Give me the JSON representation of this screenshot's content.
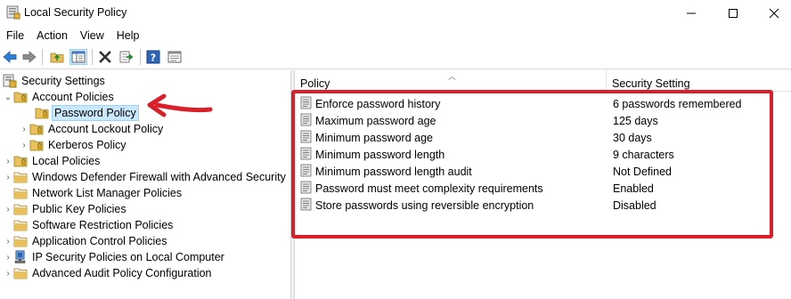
{
  "window": {
    "title": "Local Security Policy",
    "controls": [
      "minimize",
      "maximize",
      "close"
    ]
  },
  "menu": [
    "File",
    "Action",
    "View",
    "Help"
  ],
  "toolbar": {
    "buttons": [
      "back-icon",
      "forward-icon",
      "up-folder-icon",
      "show-hide-tree-icon",
      "delete-icon",
      "export-list-icon",
      "help-icon",
      "properties-icon"
    ]
  },
  "tree": {
    "root": "Security Settings",
    "items": [
      {
        "label": "Account Policies",
        "expanded": true,
        "level": 1
      },
      {
        "label": "Password Policy",
        "selected": true,
        "level": 2
      },
      {
        "label": "Account Lockout Policy",
        "level": 2
      },
      {
        "label": "Kerberos Policy",
        "level": 2
      },
      {
        "label": "Local Policies",
        "level": 1
      },
      {
        "label": "Windows Defender Firewall with Advanced Security",
        "level": 1
      },
      {
        "label": "Network List Manager Policies",
        "level": 1
      },
      {
        "label": "Public Key Policies",
        "level": 1
      },
      {
        "label": "Software Restriction Policies",
        "level": 1
      },
      {
        "label": "Application Control Policies",
        "level": 1
      },
      {
        "label": "IP Security Policies on Local Computer",
        "level": 1
      },
      {
        "label": "Advanced Audit Policy Configuration",
        "level": 1
      }
    ]
  },
  "list": {
    "columns": [
      "Policy",
      "Security Setting"
    ],
    "rows": [
      {
        "policy": "Enforce password history",
        "setting": "6 passwords remembered"
      },
      {
        "policy": "Maximum password age",
        "setting": "125 days"
      },
      {
        "policy": "Minimum password age",
        "setting": "30 days"
      },
      {
        "policy": "Minimum password length",
        "setting": "9 characters"
      },
      {
        "policy": "Minimum password length audit",
        "setting": "Not Defined"
      },
      {
        "policy": "Password must meet complexity requirements",
        "setting": "Enabled"
      },
      {
        "policy": "Store passwords using reversible encryption",
        "setting": "Disabled"
      }
    ]
  },
  "colors": {
    "annotation": "#d81f2a",
    "selection_bg": "#cce8ff",
    "selection_border": "#99d1ff",
    "folder": "#e8c15a"
  }
}
